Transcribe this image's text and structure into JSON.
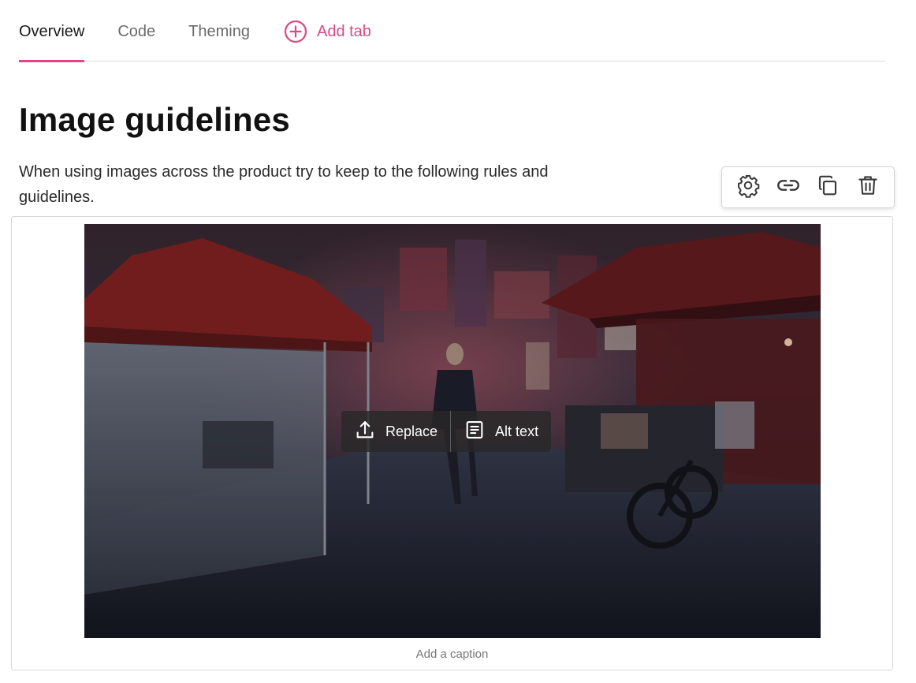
{
  "tabs": {
    "items": [
      {
        "label": "Overview",
        "active": true
      },
      {
        "label": "Code",
        "active": false
      },
      {
        "label": "Theming",
        "active": false
      }
    ],
    "add_label": "Add tab",
    "accent_color": "#d94a86"
  },
  "page": {
    "title": "Image guidelines",
    "intro": "When using images across the product try to keep to the following rules and guidelines."
  },
  "block_toolbar": {
    "icons": [
      "gear-icon",
      "link-icon",
      "duplicate-icon",
      "trash-icon"
    ]
  },
  "image_block": {
    "overlay": {
      "replace_label": "Replace",
      "alt_text_label": "Alt text"
    },
    "caption_placeholder": "Add a caption"
  }
}
